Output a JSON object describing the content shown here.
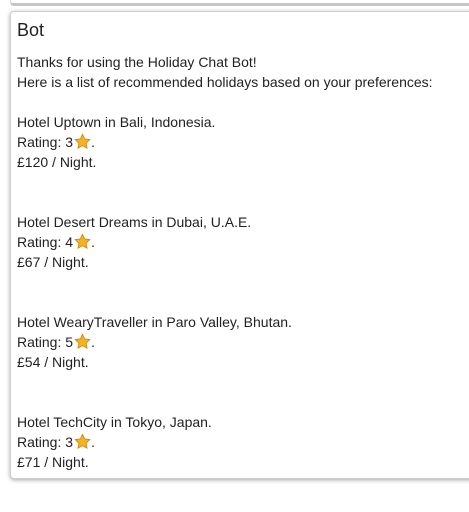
{
  "message": {
    "sender": "Bot",
    "intro": [
      "Thanks for using the Holiday Chat Bot!",
      "Here is a list of recommended holidays based on your preferences:"
    ],
    "rating_label": "Rating: ",
    "rating_suffix": ".",
    "star_icon": "star-icon",
    "star_color": "#f5b324",
    "hotels": [
      {
        "name": "Hotel Uptown in Bali, Indonesia.",
        "rating": "3",
        "price": "£120 / Night."
      },
      {
        "name": "Hotel Desert Dreams in Dubai, U.A.E.",
        "rating": "4",
        "price": "£67 / Night."
      },
      {
        "name": "Hotel WearyTraveller in Paro Valley, Bhutan.",
        "rating": "5",
        "price": "£54 / Night."
      },
      {
        "name": "Hotel TechCity in Tokyo, Japan.",
        "rating": "3",
        "price": "£71 / Night."
      }
    ]
  }
}
